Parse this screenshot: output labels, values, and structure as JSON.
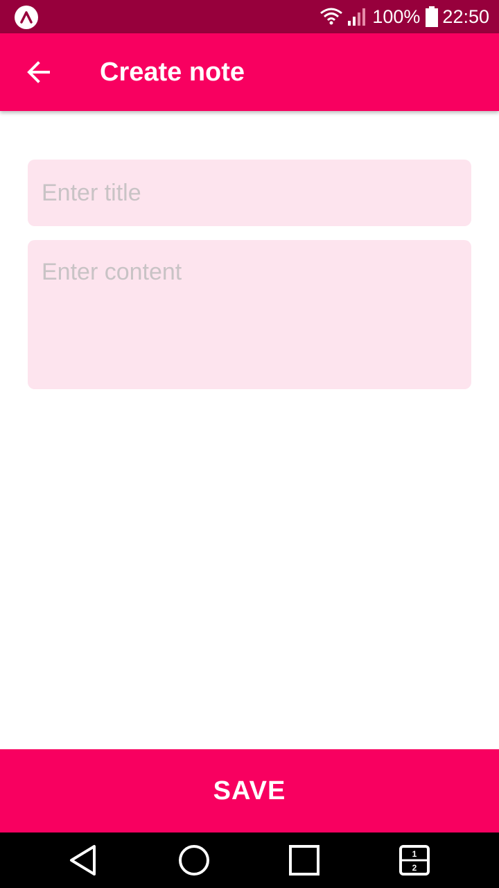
{
  "status_bar": {
    "app_icon": "android-app-icon",
    "battery_percent": "100%",
    "time": "22:50",
    "icons": [
      "wifi-icon",
      "signal-icon",
      "battery-icon"
    ],
    "color": "#97003c"
  },
  "app_bar": {
    "title": "Create note",
    "back_icon": "back-arrow-icon",
    "color": "#f80060"
  },
  "form": {
    "title_placeholder": "Enter title",
    "title_value": "",
    "content_placeholder": "Enter content",
    "content_value": "",
    "field_color": "#fde4ee"
  },
  "save_button": {
    "label": "SAVE",
    "color": "#f80060"
  },
  "nav_bar": {
    "icons": [
      "back-triangle-icon",
      "home-circle-icon",
      "recents-square-icon",
      "split-screen-icon"
    ],
    "split_labels": [
      "1",
      "2"
    ]
  }
}
